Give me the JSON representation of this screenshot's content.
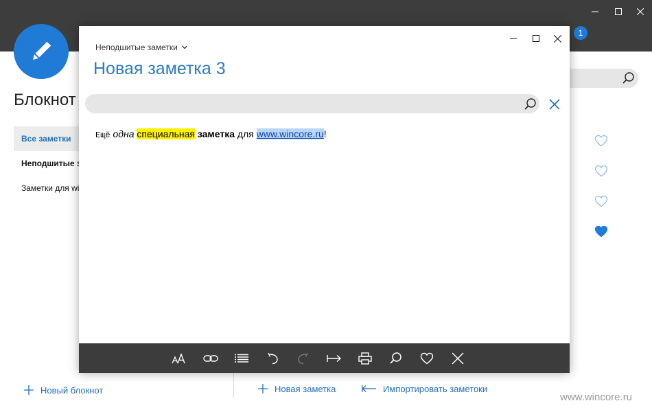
{
  "background": {
    "app_heading": "Блокнот",
    "notification_count": "1",
    "sidebar": {
      "items": [
        {
          "label": "Все заметки"
        },
        {
          "label": "Неподшитые заметки"
        },
        {
          "label": "Заметки для wincore"
        }
      ]
    },
    "favorites": [
      {
        "filled": false
      },
      {
        "filled": false
      },
      {
        "filled": false
      },
      {
        "filled": true
      }
    ],
    "bottom_bar": {
      "new_notebook": "Новый блокнот",
      "new_note": "Новая заметка",
      "import_notes": "Импортировать заметоки"
    },
    "watermark": "www.wincore.ru"
  },
  "note_window": {
    "breadcrumb": "Неподшитые заметки",
    "title": "Новая заметка 3",
    "search": {
      "value": "",
      "placeholder": ""
    },
    "body": {
      "segments": [
        {
          "text": "Ещё",
          "style": "monospace"
        },
        {
          "text": "одна",
          "style": "italic"
        },
        {
          "text": "специальная",
          "style": "highlight-yellow"
        },
        {
          "text": "заметка",
          "style": "bold"
        },
        {
          "text": "для",
          "style": "plain"
        },
        {
          "text": "www.wincore.ru",
          "style": "link"
        },
        {
          "text": "!",
          "style": "plain"
        }
      ]
    },
    "toolbar": [
      "font-size-icon",
      "link-icon",
      "list-icon",
      "undo-icon",
      "redo-icon",
      "indent-icon",
      "print-icon",
      "search-icon",
      "heart-icon",
      "close-icon"
    ]
  },
  "colors": {
    "accent": "#1f7bd6",
    "title_blue": "#2b7bc5",
    "titlebar_dark": "#3d3d3d",
    "toolbar_dark": "#3c3c3c",
    "highlight": "#fff200"
  }
}
